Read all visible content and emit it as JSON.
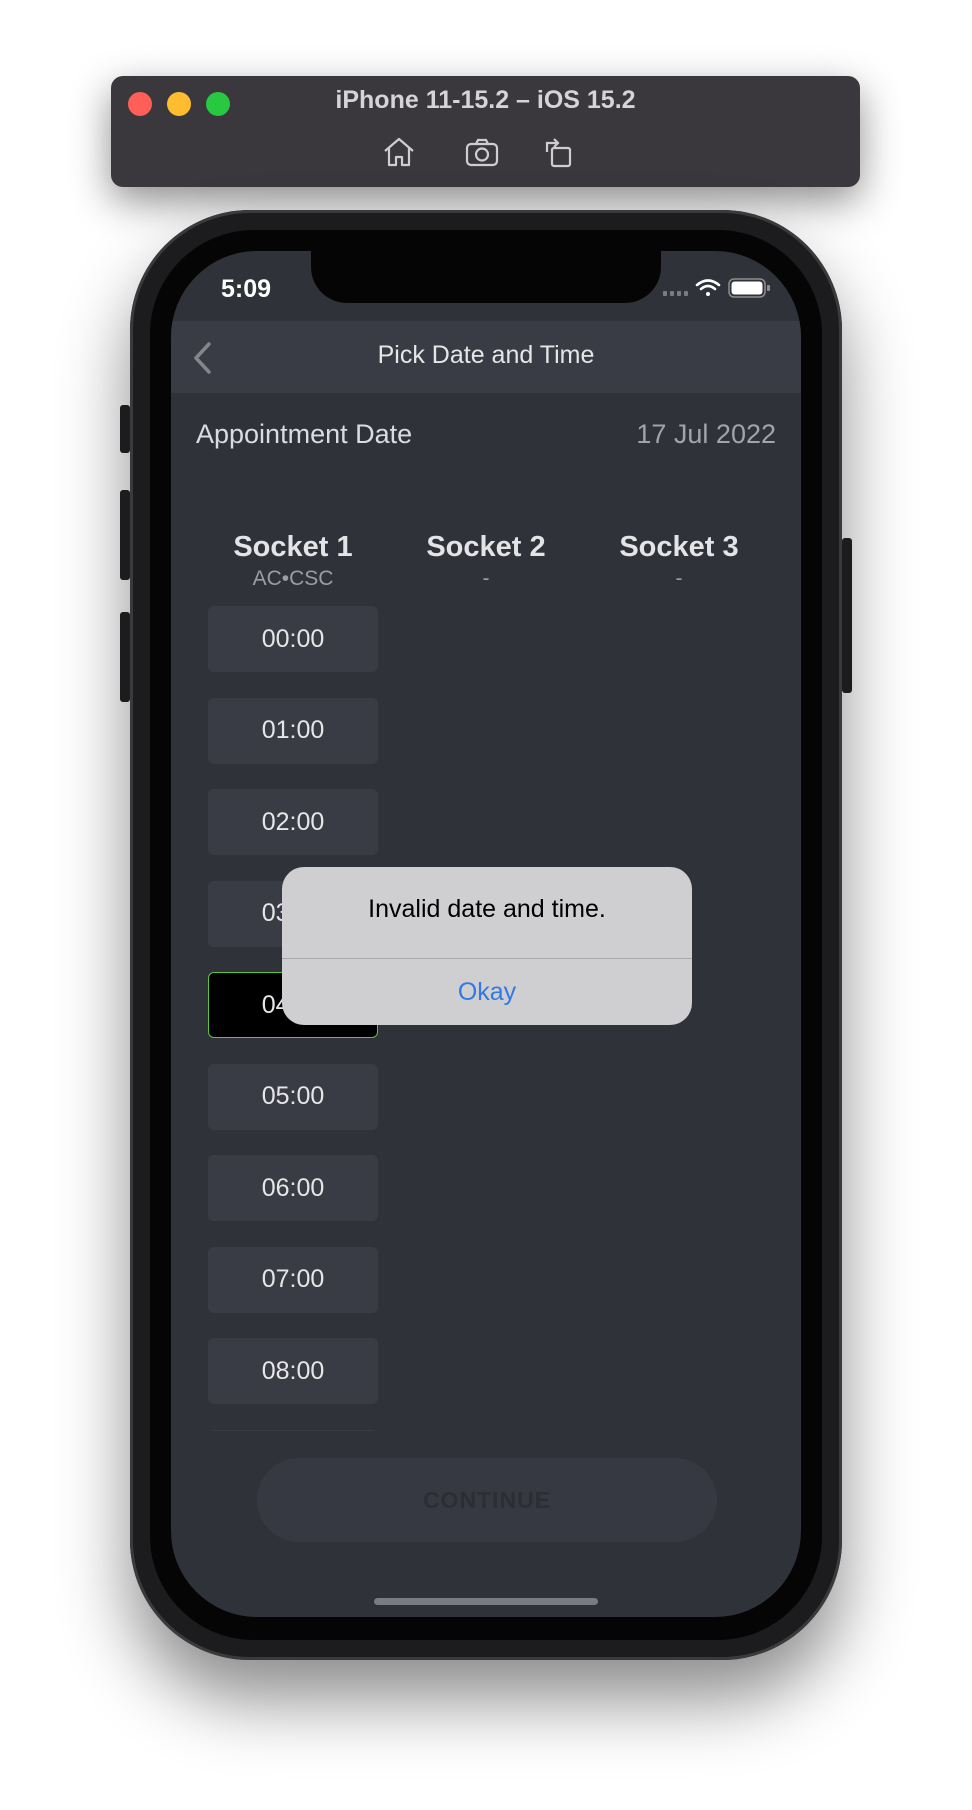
{
  "simulator": {
    "title": "iPhone 11-15.2 – iOS 15.2",
    "toolbar_icons": [
      "home-icon",
      "screenshot-camera-icon",
      "rotate-icon"
    ]
  },
  "status_bar": {
    "time": "5:09",
    "icons": [
      "cellular-signal-icon",
      "wifi-icon",
      "battery-icon"
    ]
  },
  "nav": {
    "title": "Pick Date and Time",
    "back_icon": "chevron-left-icon"
  },
  "appointment": {
    "label": "Appointment Date",
    "value": "17 Jul 2022"
  },
  "sockets": [
    {
      "name": "Socket 1",
      "sub": "AC•CSC"
    },
    {
      "name": "Socket 2",
      "sub": "-"
    },
    {
      "name": "Socket 3",
      "sub": "-"
    }
  ],
  "slots": [
    "00:00",
    "01:00",
    "02:00",
    "03:00",
    "04:00",
    "05:00",
    "06:00",
    "07:00",
    "08:00"
  ],
  "selected_slot": "04:00",
  "continue_label": "CONTINUE",
  "alert": {
    "message": "Invalid date and time.",
    "button": "Okay"
  },
  "colors": {
    "screen_bg": "#30323a",
    "navbar_bg": "#3a3c45",
    "slot_bg": "#3a3c45",
    "selected_border": "#5ec33a",
    "alert_bg": "#cfcfd2",
    "alert_button": "#2f7ae5"
  }
}
